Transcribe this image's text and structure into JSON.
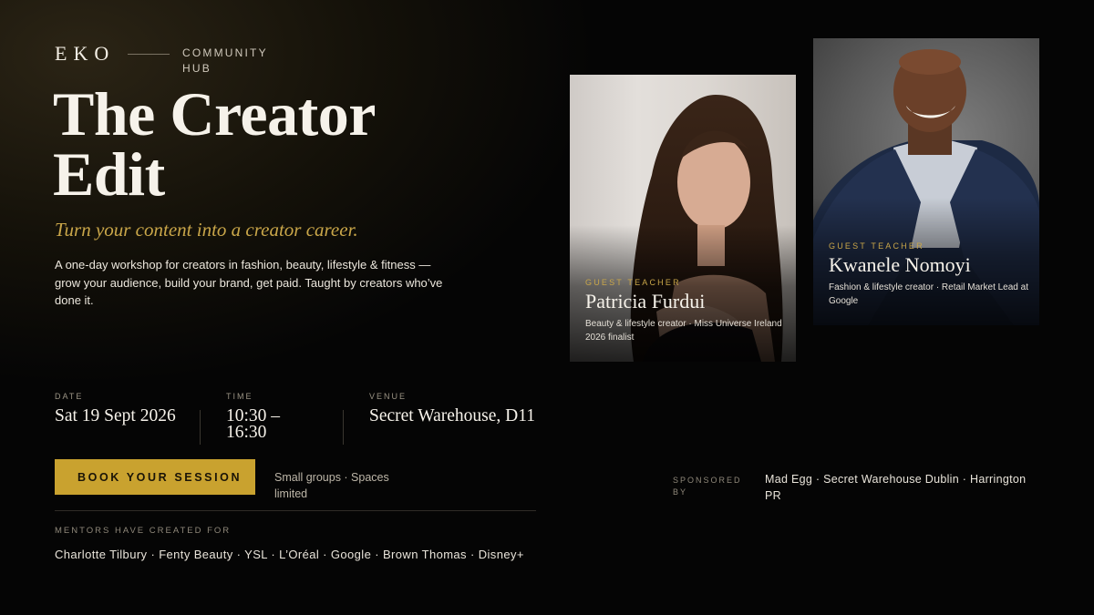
{
  "brand": {
    "logo": "EKO",
    "subtitle": "COMMUNITY HUB"
  },
  "hero": {
    "title_line1": "The Creator",
    "title_line2": "Edit",
    "tagline": "Turn your content into a creator career.",
    "description": "A one-day workshop for creators in fashion, beauty, lifestyle & fitness — grow your audience, build your brand, get paid. Taught by creators who’ve done it."
  },
  "details": {
    "date_label": "DATE",
    "date_value": "Sat 19 Sept 2026",
    "time_label": "TIME",
    "time_value": "10:30 – 16:30",
    "venue_label": "VENUE",
    "venue_value": "Secret Warehouse, D11"
  },
  "cta": {
    "button_label": "BOOK YOUR SESSION",
    "note": "Small groups · Spaces limited"
  },
  "mentors": {
    "label": "MENTORS HAVE CREATED FOR",
    "list": "Charlotte Tilbury · Fenty Beauty · YSL · L’Oréal · Google · Brown Thomas · Disney+"
  },
  "teachers": [
    {
      "label": "GUEST TEACHER",
      "name": "Patricia Furdui",
      "bio": "Beauty & lifestyle creator · Miss Universe Ireland 2026 finalist"
    },
    {
      "label": "GUEST TEACHER",
      "name": "Kwanele Nomoyi",
      "bio": "Fashion & lifestyle creator · Retail Market Lead at Google"
    }
  ],
  "sponsors": {
    "label": "SPONSORED BY",
    "list": "Mad Egg · Secret Warehouse Dublin · Harrington PR"
  },
  "colors": {
    "accent_gold": "#c9a22f",
    "background": "#050505",
    "text": "#f3eee4"
  }
}
